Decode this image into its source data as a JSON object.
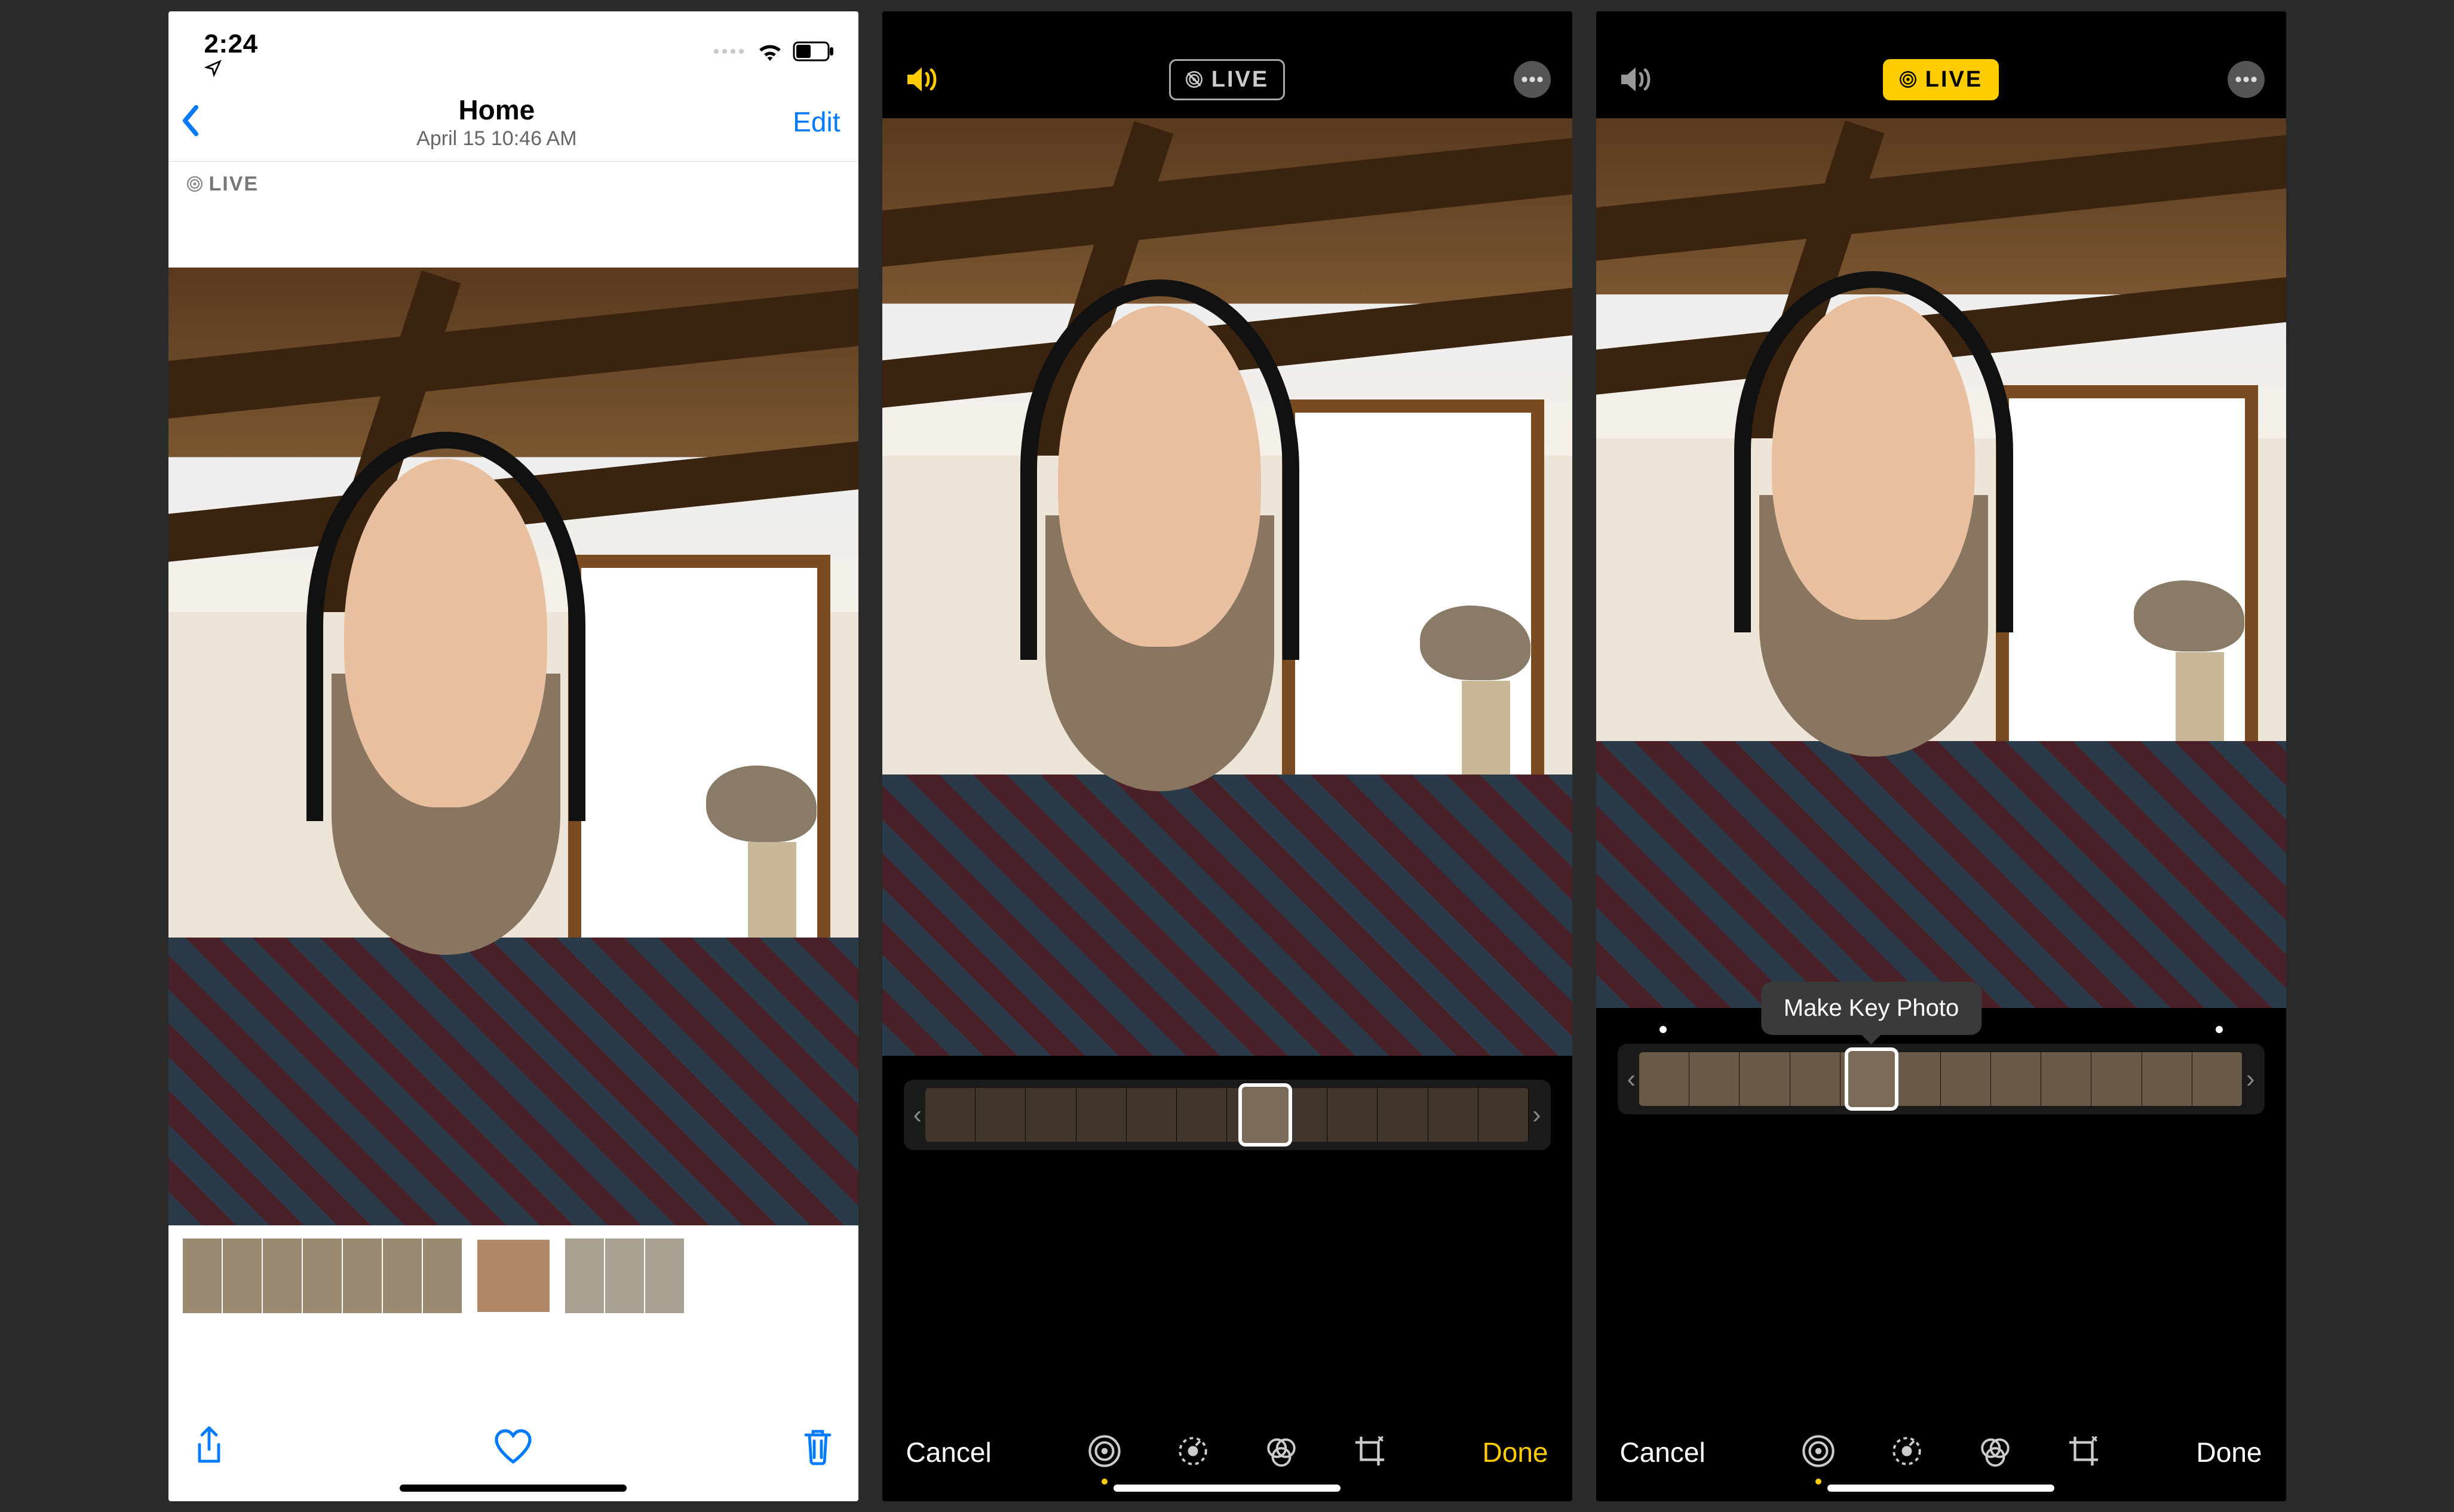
{
  "phone1": {
    "status": {
      "time": "2:24"
    },
    "nav": {
      "title": "Home",
      "subtitle": "April 15  10:46 AM",
      "edit": "Edit"
    },
    "live_badge": "LIVE"
  },
  "phone2": {
    "live_pill": "LIVE",
    "toolbar": {
      "cancel": "Cancel",
      "done": "Done"
    }
  },
  "phone3": {
    "live_pill": "LIVE",
    "tooltip": "Make Key Photo",
    "toolbar": {
      "cancel": "Cancel",
      "done": "Done"
    }
  }
}
